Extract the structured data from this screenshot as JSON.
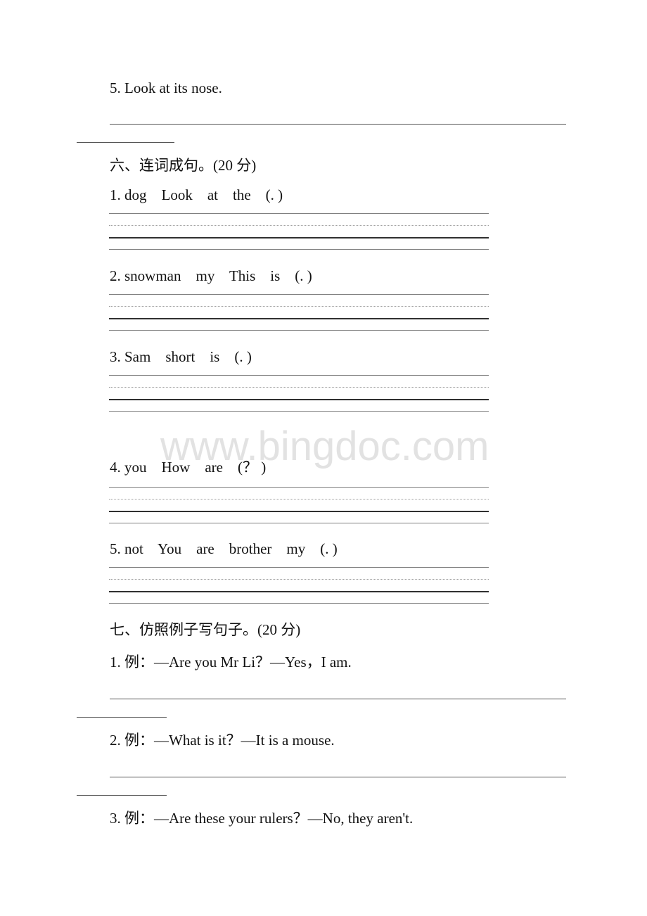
{
  "previous_item": {
    "text": "5. Look at its nose."
  },
  "section6": {
    "heading": "六、连词成句。(20 分)",
    "items": [
      {
        "text": "1. dog    Look    at    the    (. )"
      },
      {
        "text": "2. snowman    my    This    is    (. )"
      },
      {
        "text": "3. Sam    short    is    (. )"
      },
      {
        "text": "4. you    How    are    (？ )"
      },
      {
        "text": "5. not    You    are    brother    my    (. )"
      }
    ]
  },
  "section7": {
    "heading": "七、仿照例子写句子。(20 分)",
    "items": [
      {
        "text": "1. 例：—Are you Mr Li？—Yes，I am."
      },
      {
        "text": "2. 例：—What is it？—It is a mouse."
      },
      {
        "text": "3. 例：—Are these your rulers？—No, they aren't."
      }
    ]
  },
  "watermark": {
    "text": "www.bingdoc.com"
  }
}
